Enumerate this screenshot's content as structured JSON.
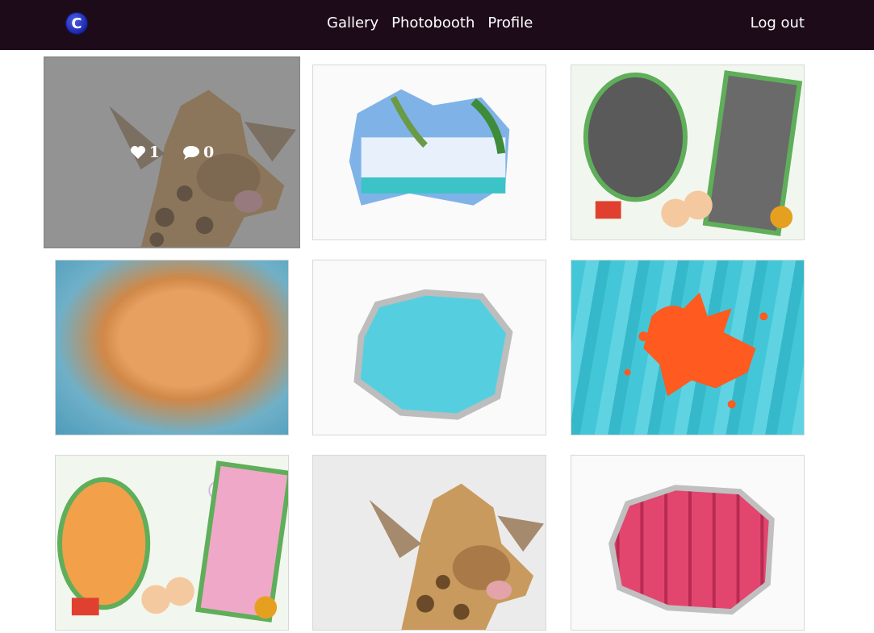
{
  "nav": {
    "logo_letter": "C",
    "links": [
      "Gallery",
      "Photobooth",
      "Profile"
    ],
    "logout": "Log out"
  },
  "gallery": {
    "hovered": {
      "likes": "1",
      "comments": "0"
    }
  }
}
